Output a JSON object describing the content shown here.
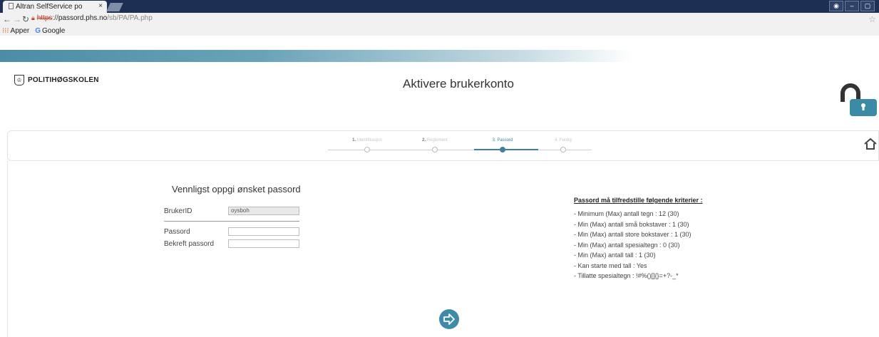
{
  "browser": {
    "tab_title": "Altran SelfService po",
    "tab_close": "×",
    "address": {
      "scheme": "https",
      "separator": "://",
      "domain": "passord.phs.no",
      "path": "/sb/PA/PA.php"
    },
    "bookmarks": [
      {
        "label": "Apper",
        "icon": "apps-grid-icon"
      },
      {
        "label": "Google",
        "icon": "google-g-icon"
      }
    ],
    "window_buttons": [
      "user-icon",
      "minimize-icon",
      "maximize-icon"
    ]
  },
  "page": {
    "logo_text": "POLITIHØGSKOLEN",
    "title": "Aktivere brukerkonto",
    "lock_icon": "padlock-open-icon",
    "home_icon": "home-icon",
    "accent_color": "#3f7f9f"
  },
  "wizard": {
    "steps": [
      {
        "num": "1.",
        "label": "Identifikasjon",
        "active": false
      },
      {
        "num": "2.",
        "label": "Reglement",
        "active": false
      },
      {
        "num": "3.",
        "label": "Passord",
        "active": true
      },
      {
        "num": "4.",
        "label": "Ferdig",
        "active": false
      }
    ]
  },
  "form": {
    "title": "Vennligst oppgi ønsket passord",
    "userid_label": "BrukerID",
    "userid_value": "oysboh",
    "password_label": "Passord",
    "password_value": "",
    "confirm_label": "Bekreft passord",
    "confirm_value": ""
  },
  "criteria": {
    "title": "Passord må tilfredstille følgende kriterier :",
    "items": [
      "- Minimum (Max) antall tegn : 12 (30)",
      "- Min (Max) antall små bokstaver : 1 (30)",
      "- Min (Max) antall store bokstaver : 1 (30)",
      "- Min (Max) antall spesialtegn : 0 (30)",
      "- Min (Max) antall tall : 1 (30)",
      "- Kan starte med tall : Yes",
      "- Tillatte spesialtegn : !#%()[]{}=+?-_*"
    ]
  },
  "next_button_icon": "arrow-right-icon"
}
